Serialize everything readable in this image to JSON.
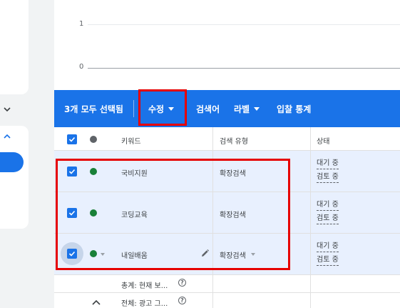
{
  "chart": {
    "ticks": [
      "1",
      "0"
    ]
  },
  "sidebar": {
    "expand_icon": "chevron-down-icon",
    "collapse_icon": "chevron-up-icon"
  },
  "action_bar": {
    "selected_text": "3개 모두 선택됨",
    "edit_label": "수정",
    "search_terms_label": "검색어",
    "labels_label": "라벨",
    "bid_stats_label": "입찰 통계"
  },
  "table": {
    "headers": {
      "keyword": "키워드",
      "match_type": "검색 유형",
      "status": "상태"
    },
    "rows": [
      {
        "keyword": "국비지원",
        "match_type": "확장검색",
        "status_line1": "대기 중",
        "status_line2": "검토 중"
      },
      {
        "keyword": "코딩교육",
        "match_type": "확장검색",
        "status_line1": "대기 중",
        "status_line2": "검토 중"
      },
      {
        "keyword": "내일배움",
        "match_type": "확장검색",
        "status_line1": "대기 중",
        "status_line2": "검토 중"
      }
    ],
    "summary": [
      {
        "label": "총계: 현재 보..."
      },
      {
        "label": "전체: 광고 그..."
      }
    ]
  },
  "colors": {
    "accent": "#1a73e8",
    "enabled_status": "#188038",
    "highlight_border": "#e60000",
    "row_selected_bg": "#e8f0fe"
  }
}
